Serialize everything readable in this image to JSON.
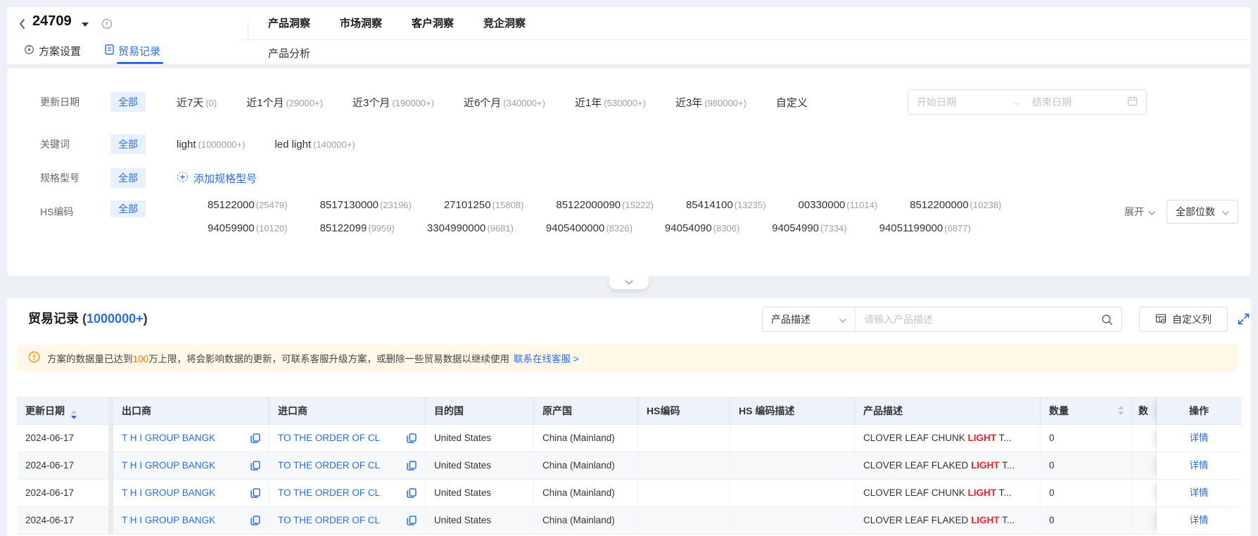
{
  "topbar": {
    "plan_id": "24709",
    "nav_tabs": [
      {
        "label": "产品洞察"
      },
      {
        "label": "市场洞察"
      },
      {
        "label": "客户洞察"
      },
      {
        "label": "竞企洞察"
      }
    ],
    "sub_tab": "产品分析",
    "left_tabs": {
      "settings": "方案设置",
      "trade_records": "贸易记录"
    }
  },
  "filters": {
    "update_date": {
      "label": "更新日期",
      "all": "全部",
      "options": [
        {
          "text": "近7天",
          "count": "(0)"
        },
        {
          "text": "近1个月",
          "count": "(29000+)"
        },
        {
          "text": "近3个月",
          "count": "(190000+)"
        },
        {
          "text": "近6个月",
          "count": "(340000+)"
        },
        {
          "text": "近1年",
          "count": "(530000+)"
        },
        {
          "text": "近3年",
          "count": "(980000+)"
        }
      ],
      "custom": "自定义",
      "start_placeholder": "开始日期",
      "end_placeholder": "结束日期",
      "arrow": "→"
    },
    "keyword": {
      "label": "关键词",
      "all": "全部",
      "options": [
        {
          "text": "light",
          "count": "(1000000+)"
        },
        {
          "text": "led light",
          "count": "(140000+)"
        }
      ]
    },
    "spec": {
      "label": "规格型号",
      "all": "全部",
      "add_label": "添加规格型号"
    },
    "hs_code": {
      "label": "HS编码",
      "all": "全部",
      "row1": [
        {
          "text": "85122000",
          "count": "(25479)"
        },
        {
          "text": "8517130000",
          "count": "(23196)"
        },
        {
          "text": "27101250",
          "count": "(15808)"
        },
        {
          "text": "85122000090",
          "count": "(15222)"
        },
        {
          "text": "85414100",
          "count": "(13235)"
        },
        {
          "text": "00330000",
          "count": "(11014)"
        },
        {
          "text": "8512200000",
          "count": "(10238)"
        }
      ],
      "row2": [
        {
          "text": "94059900",
          "count": "(10120)"
        },
        {
          "text": "85122099",
          "count": "(9959)"
        },
        {
          "text": "3304990000",
          "count": "(9681)"
        },
        {
          "text": "9405400000",
          "count": "(8326)"
        },
        {
          "text": "94054090",
          "count": "(8306)"
        },
        {
          "text": "94054990",
          "count": "(7334)"
        },
        {
          "text": "94051199000",
          "count": "(6877)"
        }
      ],
      "expand_label": "展开",
      "digits_label": "全部位数"
    }
  },
  "records": {
    "title": "贸易记录",
    "count_paren_open": "(",
    "count": "1000000+",
    "count_paren_close": ")",
    "search_type": "产品描述",
    "search_placeholder": "请输入产品描述",
    "customize_columns": "自定义列",
    "banner": {
      "pre": "方案的数据量已达到",
      "highlight": "100",
      "post": "万上限，将会影响数据的更新，可联系客服升级方案，或删除一些贸易数据以继续使用",
      "link": "联系在线客服 >"
    },
    "table": {
      "headers": [
        "更新日期",
        "出口商",
        "进口商",
        "目的国",
        "原产国",
        "HS编码",
        "HS 编码描述",
        "产品描述",
        "数量",
        "数",
        "操作"
      ],
      "rows": [
        {
          "date": "2024-06-17",
          "exporter": "T H I GROUP BANGK",
          "importer": "TO THE ORDER OF CL",
          "dest": "United States",
          "origin": "China (Mainland)",
          "hs": "",
          "hs_desc": "",
          "desc_pre": "CLOVER LEAF CHUNK ",
          "desc_hl": "LIGHT",
          "desc_suf": " T...",
          "qty": "0",
          "action": "详情"
        },
        {
          "date": "2024-06-17",
          "exporter": "T H I GROUP BANGK",
          "importer": "TO THE ORDER OF CL",
          "dest": "United States",
          "origin": "China (Mainland)",
          "hs": "",
          "hs_desc": "",
          "desc_pre": "CLOVER LEAF FLAKED ",
          "desc_hl": "LIGHT",
          "desc_suf": " T...",
          "qty": "0",
          "action": "详情"
        },
        {
          "date": "2024-06-17",
          "exporter": "T H I GROUP BANGK",
          "importer": "TO THE ORDER OF CL",
          "dest": "United States",
          "origin": "China (Mainland)",
          "hs": "",
          "hs_desc": "",
          "desc_pre": "CLOVER LEAF CHUNK ",
          "desc_hl": "LIGHT",
          "desc_suf": " T...",
          "qty": "0",
          "action": "详情"
        },
        {
          "date": "2024-06-17",
          "exporter": "T H I GROUP BANGK",
          "importer": "TO THE ORDER OF CL",
          "dest": "United States",
          "origin": "China (Mainland)",
          "hs": "",
          "hs_desc": "",
          "desc_pre": "CLOVER LEAF FLAKED ",
          "desc_hl": "LIGHT",
          "desc_suf": " T...",
          "qty": "0",
          "action": "详情"
        }
      ]
    }
  },
  "colors": {
    "primary_blue": "#2b6de0",
    "highlight_red": "#f5222d",
    "warning_orange": "#ff7d00",
    "banner_bg": "#fff7e8",
    "header_bg": "#eef2fa"
  }
}
